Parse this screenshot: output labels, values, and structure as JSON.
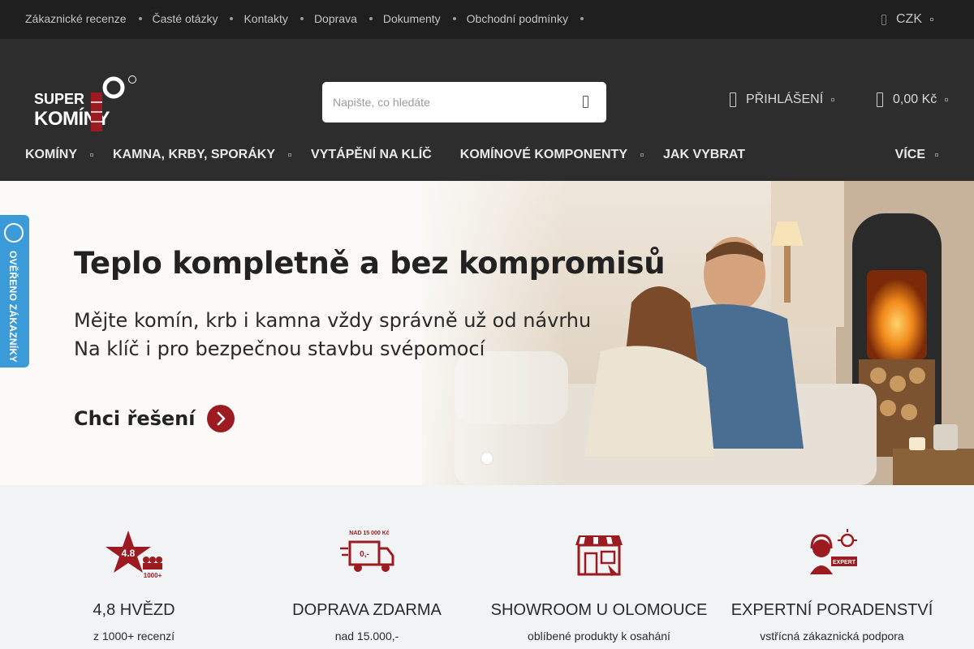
{
  "topbar": {
    "links": [
      "Zákaznické recenze",
      "Časté otázky",
      "Kontakty",
      "Doprava",
      "Dokumenty",
      "Obchodní podmínky"
    ],
    "currency": "CZK"
  },
  "header": {
    "logo_text_top": "SUPER",
    "logo_text_bottom": "KOMÍNY",
    "search_placeholder": "Napište, co hledáte",
    "login_label": "PŘIHLÁŠENÍ",
    "cart_total": "0,00 Kč",
    "nav": [
      {
        "label": "KOMÍNY",
        "has_dropdown": true
      },
      {
        "label": "KAMNA, KRBY, SPORÁKY",
        "has_dropdown": true
      },
      {
        "label": "VYTÁPĚNÍ NA KLÍČ",
        "has_dropdown": false
      },
      {
        "label": "KOMÍNOVÉ KOMPONENTY",
        "has_dropdown": true
      },
      {
        "label": "JAK VYBRAT",
        "has_dropdown": false
      }
    ],
    "more_label": "VÍCE"
  },
  "hero": {
    "title": "Teplo kompletně a bez kompromisů",
    "subtitle_line1": "Mějte komín, krb i kamna vždy správně už od návrhu",
    "subtitle_line2": "Na klíč i pro bezpečnou stavbu svépomocí",
    "cta_label": "Chci řešení",
    "slides_count": 1,
    "active_slide": 1
  },
  "badge": {
    "label": "OVĚŘENO ZÁKAZNÍKY"
  },
  "features": [
    {
      "icon": "star-rating-icon",
      "icon_text": "4.8",
      "icon_subtext": "1000+",
      "title": "4,8 HVĚZD",
      "subtitle": "z 1000+ recenzí"
    },
    {
      "icon": "delivery-truck-icon",
      "icon_text": "NAD 15 000 Kč",
      "icon_subtext": "0,-",
      "title": "DOPRAVA ZDARMA",
      "subtitle": "nad 15.000,-"
    },
    {
      "icon": "showroom-store-icon",
      "title": "SHOWROOM U OLOMOUCE",
      "subtitle": "oblíbené produkty k osahání"
    },
    {
      "icon": "expert-support-icon",
      "icon_text": "EXPERT",
      "title": "EXPERTNÍ PORADENSTVÍ",
      "subtitle": "vstřícná zákaznická podpora"
    }
  ],
  "colors": {
    "brand_red": "#9b1b20",
    "topbar_bg": "#1f1f1f",
    "header_bg": "#2d2d2d",
    "badge_blue": "#3b9bd9"
  }
}
